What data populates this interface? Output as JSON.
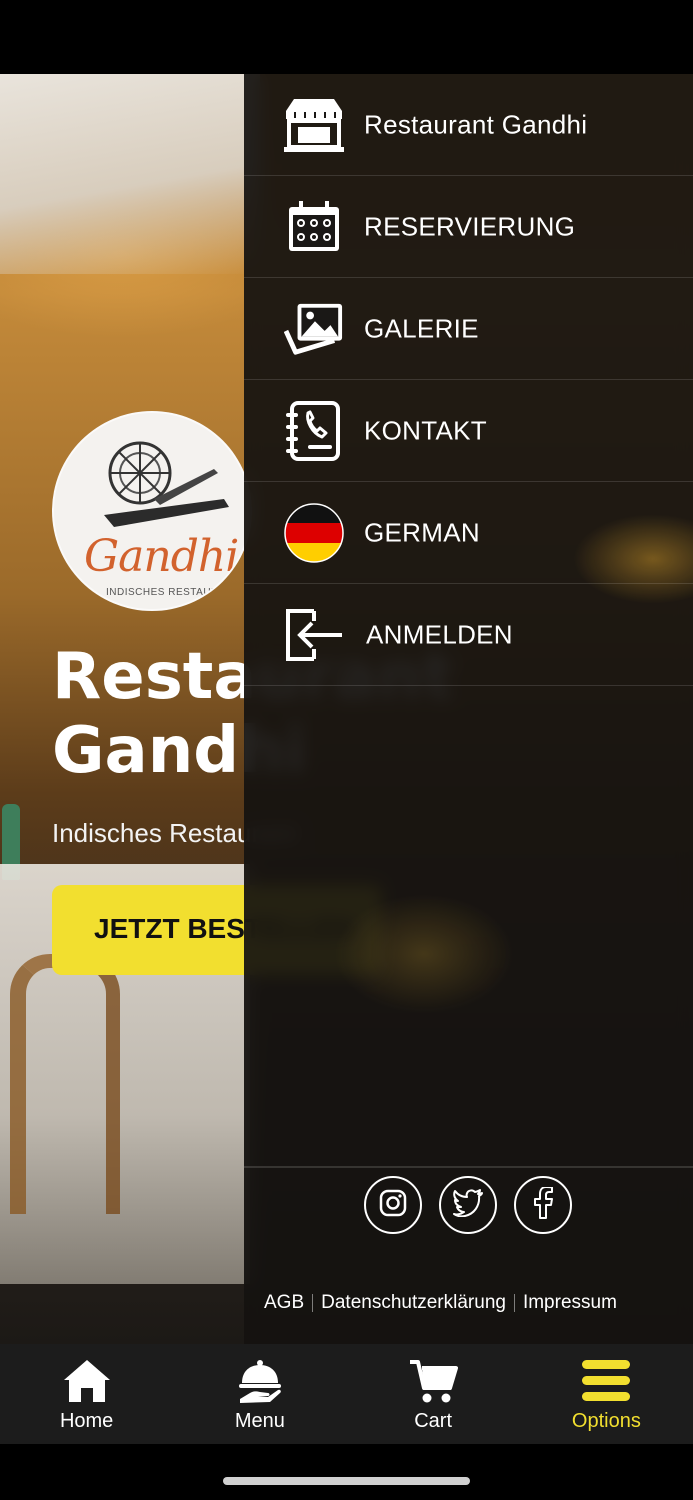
{
  "hero": {
    "logo_script": "Gandhi",
    "logo_sub": "INDISCHES RESTAURANT",
    "title_line1": "Restaurant",
    "title_line2": "Gandhi",
    "subtitle": "Indisches Restaurant",
    "order_button_label": "JETZT BESTELLEN"
  },
  "drawer": {
    "items": [
      {
        "label": "Restaurant Gandhi",
        "icon": "store-icon"
      },
      {
        "label": "RESERVIERUNG",
        "icon": "calendar-icon"
      },
      {
        "label": "GALERIE",
        "icon": "gallery-icon"
      },
      {
        "label": "KONTAKT",
        "icon": "contact-book-icon"
      },
      {
        "label": "GERMAN",
        "icon": "german-flag-icon"
      },
      {
        "label": "ANMELDEN",
        "icon": "login-icon"
      }
    ],
    "social": [
      "instagram-icon",
      "twitter-icon",
      "facebook-icon"
    ],
    "legal": {
      "agb": "AGB",
      "privacy": "Datenschutzerklärung",
      "imprint": "Impressum"
    }
  },
  "bottom_nav": {
    "items": [
      {
        "label": "Home",
        "icon": "home-icon"
      },
      {
        "label": "Menu",
        "icon": "food-service-icon"
      },
      {
        "label": "Cart",
        "icon": "cart-icon"
      },
      {
        "label": "Options",
        "icon": "hamburger-icon",
        "active": true
      }
    ],
    "active_color": "#f2df2f"
  },
  "colors": {
    "accent": "#f2df2f",
    "drawer_bg": "#141210"
  }
}
